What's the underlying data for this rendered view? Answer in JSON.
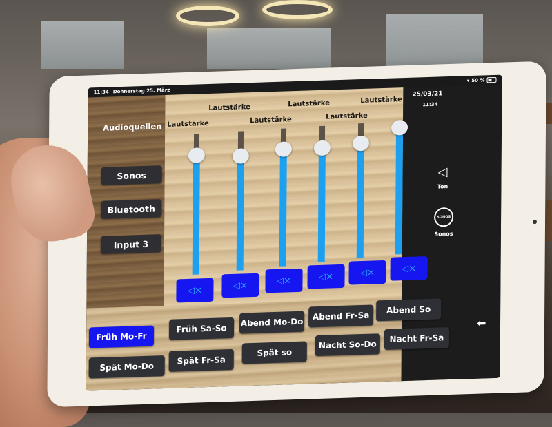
{
  "status_bar": {
    "time": "11:34",
    "date": "Donnerstag 25. März",
    "battery": "50 %"
  },
  "header": {
    "date": "25/03/21",
    "time": "11:34"
  },
  "sources": {
    "heading": "Audioquellen",
    "items": [
      {
        "label": "Sonos"
      },
      {
        "label": "Bluetooth"
      },
      {
        "label": "Input 3"
      }
    ]
  },
  "volume": {
    "channels": [
      {
        "label": "Lautstärke",
        "level_percent": 85,
        "mute_icon": "speaker-mute-icon"
      },
      {
        "label": "Lautstärke",
        "level_percent": 82,
        "mute_icon": "speaker-mute-icon"
      },
      {
        "label": "Lautstärke",
        "level_percent": 85,
        "mute_icon": "speaker-mute-icon"
      },
      {
        "label": "Lautstärke",
        "level_percent": 84,
        "mute_icon": "speaker-mute-icon"
      },
      {
        "label": "Lautstärke",
        "level_percent": 85,
        "mute_icon": "speaker-mute-icon"
      },
      {
        "label": "Lautstärke",
        "level_percent": 95,
        "mute_icon": "speaker-mute-icon"
      }
    ],
    "mute_glyph": "◁×"
  },
  "presets": {
    "row1": [
      {
        "label": "Früh Mo-Fr",
        "active": true
      },
      {
        "label": "Früh Sa-So",
        "active": false
      },
      {
        "label": "Abend Mo-Do",
        "active": false
      },
      {
        "label": "Abend Fr-Sa",
        "active": false
      },
      {
        "label": "Abend So",
        "active": false
      }
    ],
    "row2": [
      {
        "label": "Spät Mo-Do",
        "active": false
      },
      {
        "label": "Spät Fr-Sa",
        "active": false
      },
      {
        "label": "Spät so",
        "active": false
      },
      {
        "label": "Nacht So-Do",
        "active": false
      },
      {
        "label": "Nacht Fr-Sa",
        "active": false
      }
    ]
  },
  "sidebar": {
    "items": [
      {
        "label": "Ton",
        "icon": "speaker-icon"
      },
      {
        "label": "Sonos",
        "icon": "sonos-logo-icon",
        "logo_text": "SONOS"
      }
    ],
    "back_icon": "back-arrow-icon"
  },
  "colors": {
    "accent_blue": "#1616f0",
    "slider_fill": "#1ea0f0",
    "button_dark": "#2f3036"
  }
}
